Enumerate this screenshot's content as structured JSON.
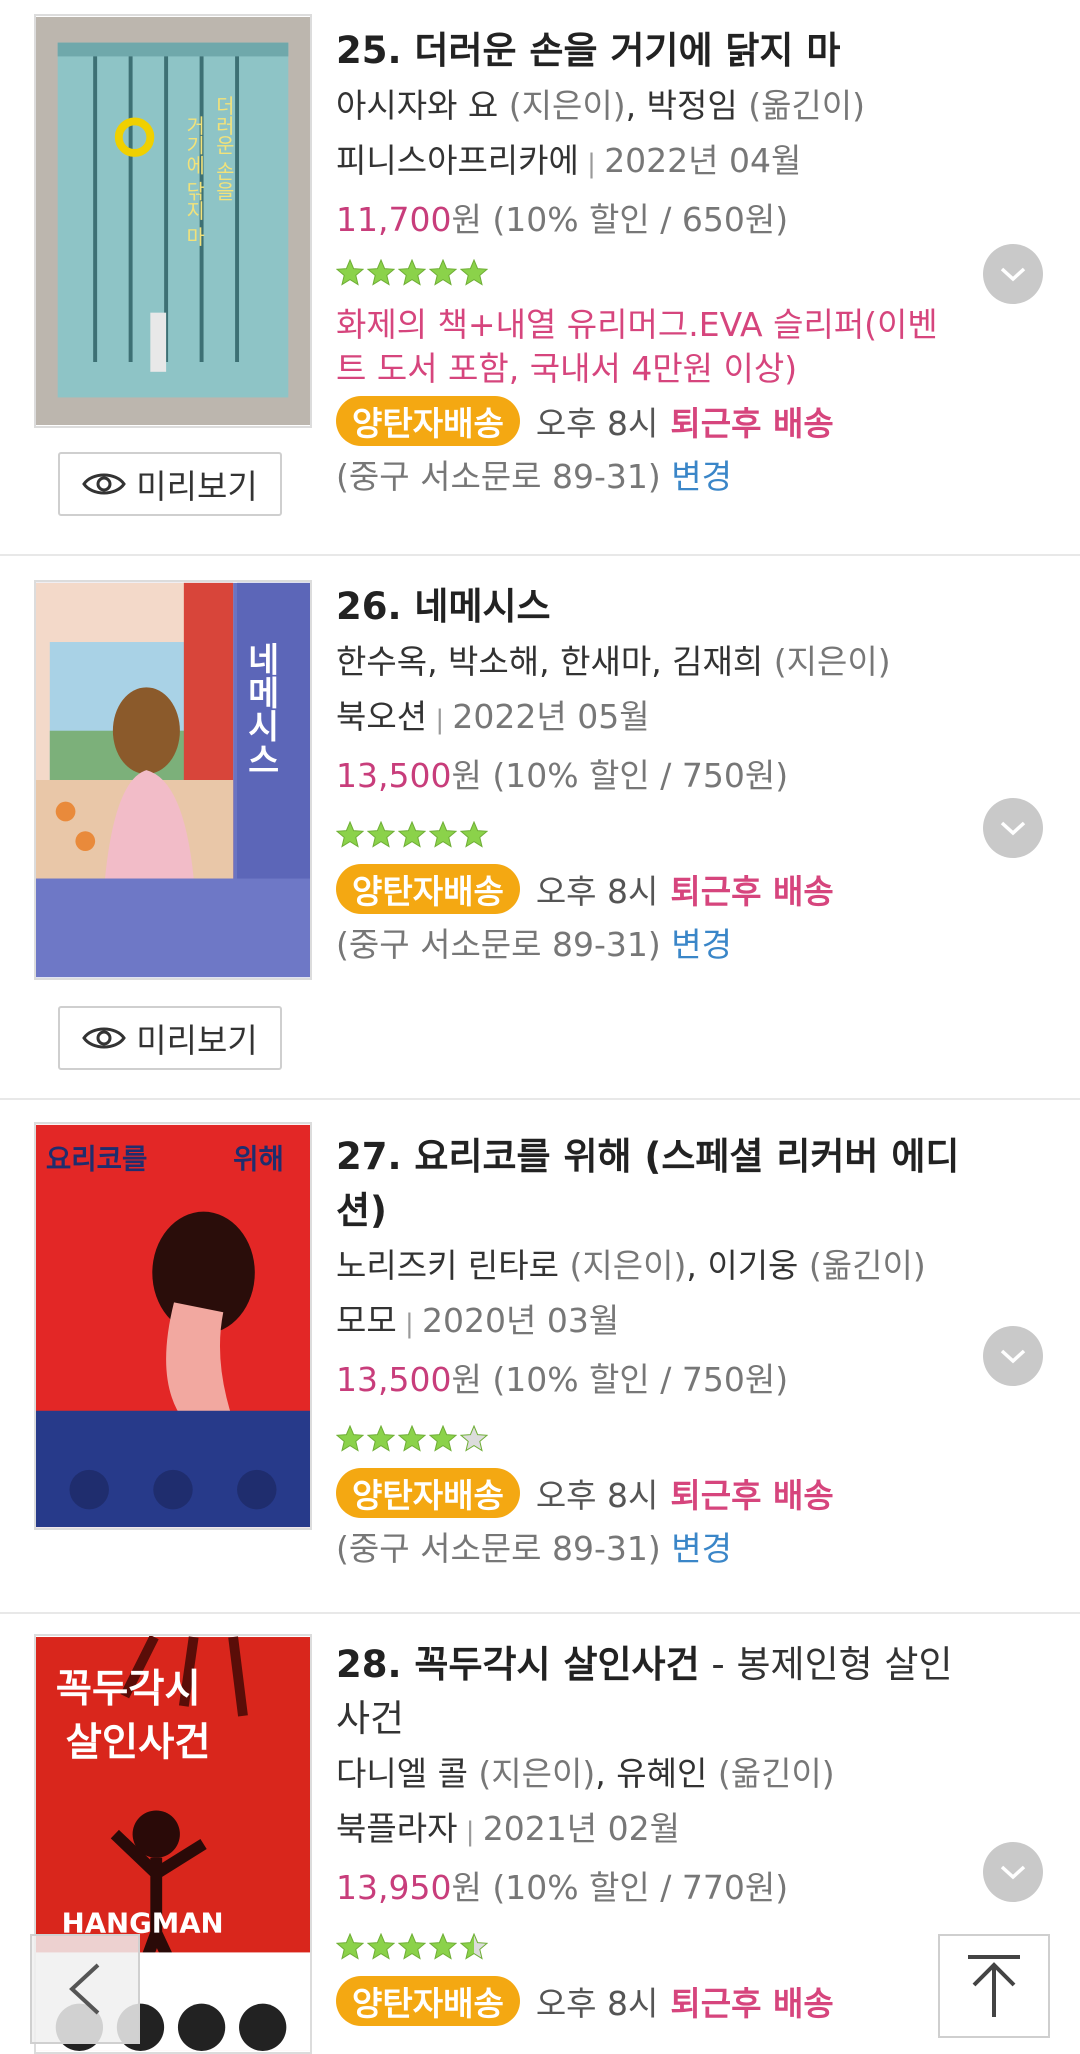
{
  "books": [
    {
      "title": "25. 더러운 손을 거기에 닭지 마",
      "subtitle": "",
      "authors": [
        {
          "name": "아시자와 요",
          "role": " (지은이)",
          "sep": ", "
        },
        {
          "name": "박정임",
          "role": " (옮긴이)",
          "sep": ""
        }
      ],
      "publisher": "피니스아프리카에",
      "pub_date": "2022년 04월",
      "price": "11,700",
      "price_unit": "원",
      "discount": " (10% 할인 / 650원)",
      "rating": 5,
      "promo": "화제의 책+내열 유리머그.EVA 슬리퍼(이벤트 도서 포함, 국내서 4만원 이상)",
      "shipping_badge": "양탄자배송",
      "shipping_time": "오후 8시",
      "shipping_type": "퇴근후 배송",
      "address": "(중구 서소문로 89-31)",
      "change_label": "변경",
      "preview_label": "미리보기",
      "cover_text": [
        "더러운 손을",
        "거기에 닦지 마"
      ],
      "cover_color": "#8ec4c6"
    },
    {
      "title": "26. 네메시스",
      "subtitle": "",
      "authors": [
        {
          "name": "한수옥, 박소해, 한새마, 김재희",
          "role": " (지은이)",
          "sep": ""
        }
      ],
      "publisher": "북오션",
      "pub_date": "2022년 05월",
      "price": "13,500",
      "price_unit": "원",
      "discount": " (10% 할인 / 750원)",
      "rating": 5,
      "promo": "",
      "shipping_badge": "양탄자배송",
      "shipping_time": "오후 8시",
      "shipping_type": "퇴근후 배송",
      "address": "(중구 서소문로 89-31)",
      "change_label": "변경",
      "preview_label": "미리보기",
      "cover_text": [
        "네메시스"
      ],
      "cover_color": "#5c66b8"
    },
    {
      "title": "27. 요리코를 위해 (스페셜 리커버 에디션)",
      "subtitle": "",
      "authors": [
        {
          "name": "노리즈키 린타로",
          "role": " (지은이)",
          "sep": ", "
        },
        {
          "name": "이기웅",
          "role": " (옮긴이)",
          "sep": ""
        }
      ],
      "publisher": "모모",
      "pub_date": "2020년 03월",
      "price": "13,500",
      "price_unit": "원",
      "discount": " (10% 할인 / 750원)",
      "rating": 4,
      "promo": "",
      "shipping_badge": "양탄자배송",
      "shipping_time": "오후 8시",
      "shipping_type": "퇴근후 배송",
      "address": "(중구 서소문로 89-31)",
      "change_label": "변경",
      "preview_label": "",
      "cover_text": [
        "요리코를",
        "위해"
      ],
      "cover_color": "#e32726"
    },
    {
      "title": "28. 꼭두각시 살인사건",
      "subtitle": " - 봉제인형 살인사건",
      "authors": [
        {
          "name": "다니엘 콜",
          "role": " (지은이)",
          "sep": ", "
        },
        {
          "name": "유혜인",
          "role": " (옮긴이)",
          "sep": ""
        }
      ],
      "publisher": "북플라자",
      "pub_date": "2021년 02월",
      "price": "13,950",
      "price_unit": "원",
      "discount": " (10% 할인 / 770원)",
      "rating": 4.5,
      "promo": "",
      "shipping_badge": "양탄자배송",
      "shipping_time": "오후 8시",
      "shipping_type": "퇴근후 배송",
      "address": "",
      "change_label": "",
      "preview_label": "",
      "cover_text": [
        "꼭두각시",
        "살인사건",
        "HANGMAN"
      ],
      "cover_color": "#d9261c"
    }
  ],
  "icons": {
    "star": "star-icon",
    "eye": "eye-icon",
    "chevron": "chevron-down-icon",
    "back": "back-arrow-icon",
    "top": "scroll-top-icon"
  },
  "colors": {
    "price": "#c83d7b",
    "promo": "#d6457d",
    "badge": "#f4a812",
    "star": "#8bd24a",
    "link": "#3a86c8"
  }
}
